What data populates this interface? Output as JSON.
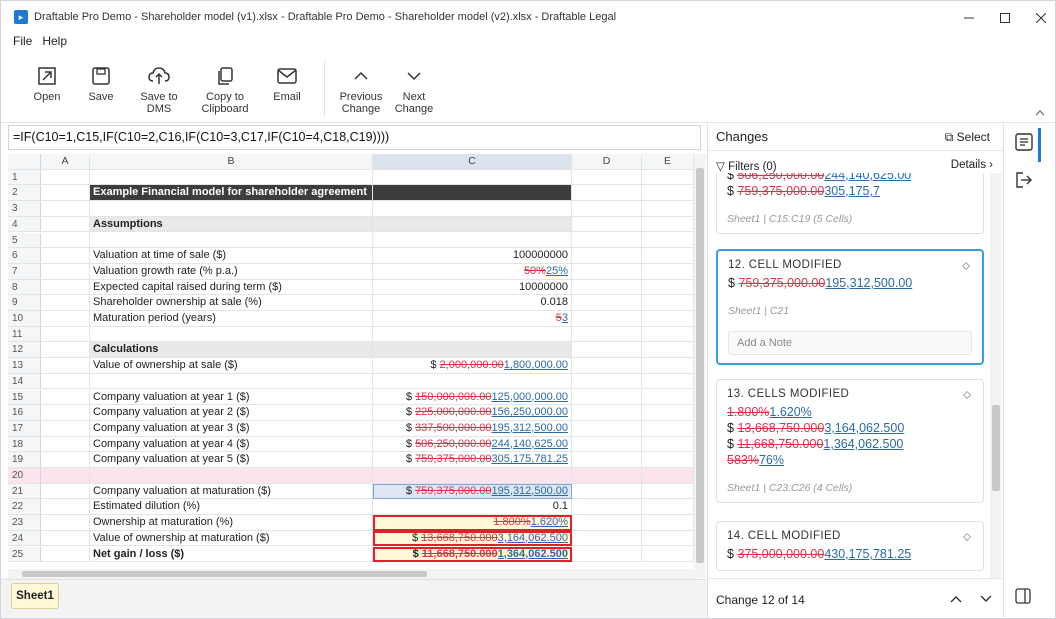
{
  "window": {
    "title": "Draftable Pro Demo - Shareholder model (v1).xlsx - Draftable Pro Demo - Shareholder model (v2).xlsx - Draftable Legal"
  },
  "menu": [
    "File",
    "Help"
  ],
  "ribbon": {
    "open": "Open",
    "save": "Save",
    "save_dms": "Save to\nDMS",
    "copy": "Copy to\nClipboard",
    "email": "Email",
    "prev": "Previous\nChange",
    "next": "Next\nChange"
  },
  "formula": "=IF(C10=1,C15,IF(C10=2,C16,IF(C10=3,C17,IF(C10=4,C18,C19))))",
  "columns": [
    "A",
    "B",
    "C",
    "D",
    "E"
  ],
  "rows": [
    {
      "n": "1",
      "b": "",
      "c": []
    },
    {
      "n": "2",
      "b": "Example Financial model for shareholder agreement",
      "c": [],
      "style": "dark"
    },
    {
      "n": "3",
      "b": "",
      "c": []
    },
    {
      "n": "4",
      "b": "Assumptions",
      "c": [],
      "style": "lgray"
    },
    {
      "n": "5",
      "b": "",
      "c": []
    },
    {
      "n": "6",
      "b": "Valuation at time of sale ($)",
      "c": [
        {
          "t": "100000000"
        }
      ]
    },
    {
      "n": "7",
      "b": "Valuation growth rate (% p.a.)",
      "c": [
        {
          "t": "50%",
          "k": "del"
        },
        {
          "t": "25%",
          "k": "ins"
        }
      ]
    },
    {
      "n": "8",
      "b": "Expected capital raised during term ($)",
      "c": [
        {
          "t": "10000000"
        }
      ]
    },
    {
      "n": "9",
      "b": "Shareholder ownership at sale (%)",
      "c": [
        {
          "t": "0.018"
        }
      ]
    },
    {
      "n": "10",
      "b": "Maturation period (years)",
      "c": [
        {
          "t": "5",
          "k": "del"
        },
        {
          "t": "3",
          "k": "ins"
        }
      ]
    },
    {
      "n": "11",
      "b": "",
      "c": []
    },
    {
      "n": "12",
      "b": "Calculations",
      "c": [],
      "style": "lgray"
    },
    {
      "n": "13",
      "b": "Value of ownership at sale ($)",
      "c": [
        {
          "t": "$ "
        },
        {
          "t": "2,000,000.00",
          "k": "del"
        },
        {
          "t": "1,800,000.00",
          "k": "ins"
        }
      ]
    },
    {
      "n": "14",
      "b": "",
      "c": []
    },
    {
      "n": "15",
      "b": "Company valuation at year 1 ($)",
      "c": [
        {
          "t": "$ "
        },
        {
          "t": "150,000,000.00",
          "k": "del"
        },
        {
          "t": "125,000,000.00",
          "k": "ins"
        }
      ]
    },
    {
      "n": "16",
      "b": "Company valuation at year 2 ($)",
      "c": [
        {
          "t": "$ "
        },
        {
          "t": "225,000,000.00",
          "k": "del"
        },
        {
          "t": "156,250,000.00",
          "k": "ins"
        }
      ]
    },
    {
      "n": "17",
      "b": "Company valuation at year 3 ($)",
      "c": [
        {
          "t": "$ "
        },
        {
          "t": "337,500,000.00",
          "k": "del"
        },
        {
          "t": "195,312,500.00",
          "k": "ins"
        }
      ]
    },
    {
      "n": "18",
      "b": "Company valuation at year 4 ($)",
      "c": [
        {
          "t": "$ "
        },
        {
          "t": "506,250,000.00",
          "k": "del"
        },
        {
          "t": "244,140,625.00",
          "k": "ins"
        }
      ]
    },
    {
      "n": "19",
      "b": "Company valuation at year 5 ($)",
      "c": [
        {
          "t": "$ "
        },
        {
          "t": "759,375,000.00",
          "k": "del"
        },
        {
          "t": "305,175,781.25",
          "k": "ins"
        }
      ]
    },
    {
      "n": "20",
      "b": "",
      "c": [],
      "style": "pink"
    },
    {
      "n": "21",
      "b": "Company valuation at maturation ($)",
      "c": [
        {
          "t": "$ "
        },
        {
          "t": "759,375,000.00",
          "k": "del"
        },
        {
          "t": "195,312,500.00",
          "k": "ins"
        }
      ],
      "cstyle": "selC"
    },
    {
      "n": "22",
      "b": "Estimated dilution (%)",
      "c": [
        {
          "t": "0.1"
        }
      ]
    },
    {
      "n": "23",
      "b": "Ownership at maturation (%)",
      "c": [
        {
          "t": "1.800%",
          "k": "del"
        },
        {
          "t": "1.620%",
          "k": "ins"
        }
      ],
      "cstyle": "redbox"
    },
    {
      "n": "24",
      "b": "Value of ownership at maturation ($)",
      "c": [
        {
          "t": "$ "
        },
        {
          "t": "13,668,750.000",
          "k": "del"
        },
        {
          "t": "3,164,062.500",
          "k": "ins"
        }
      ],
      "cstyle": "redbox"
    },
    {
      "n": "25",
      "b": "Net gain / loss ($)",
      "c": [
        {
          "t": "$ "
        },
        {
          "t": "11,668,750.000",
          "k": "del"
        },
        {
          "t": "1,364,062.500",
          "k": "ins"
        }
      ],
      "cstyle": "redbox",
      "bold": true
    }
  ],
  "sheet_tab": "Sheet1",
  "panel": {
    "title": "Changes",
    "select": "Select",
    "filters": "Filters (0)",
    "details": "Details",
    "cards": [
      {
        "heading": "",
        "lines": [
          [
            {
              "t": "$ "
            },
            {
              "t": "506,250,000.00",
              "k": "del"
            },
            {
              "t": "244,140,625.00",
              "k": "ins"
            }
          ],
          [
            {
              "t": "$ "
            },
            {
              "t": "759,375,000.00",
              "k": "del"
            },
            {
              "t": "305,175,7",
              "k": "ins"
            }
          ]
        ],
        "meta": "Sheet1 | C15:C19 (5 Cells)",
        "partial": true
      },
      {
        "heading": "12. CELL MODIFIED",
        "lines": [
          [
            {
              "t": "$ "
            },
            {
              "t": "759,375,000.00",
              "k": "del"
            },
            {
              "t": "195,312,500.00",
              "k": "ins"
            }
          ]
        ],
        "meta": "Sheet1 | C21",
        "active": true,
        "note": "Add a Note"
      },
      {
        "heading": "13. CELLS MODIFIED",
        "lines": [
          [
            {
              "t": "1.800%",
              "k": "del"
            },
            {
              "t": "1.620%",
              "k": "ins"
            }
          ],
          [
            {
              "t": "$ "
            },
            {
              "t": "13,668,750.000",
              "k": "del"
            },
            {
              "t": "3,164,062.500",
              "k": "ins"
            }
          ],
          [
            {
              "t": "$ "
            },
            {
              "t": "11,668,750.000",
              "k": "del"
            },
            {
              "t": "1,364,062.500",
              "k": "ins"
            }
          ],
          [
            {
              "t": "583%",
              "k": "del"
            },
            {
              "t": "76%",
              "k": "ins"
            }
          ]
        ],
        "meta": "Sheet1 | C23:C26 (4 Cells)"
      },
      {
        "heading": "14. CELL MODIFIED",
        "lines": [
          [
            {
              "t": "$ "
            },
            {
              "t": "375,000,000.00",
              "k": "del"
            },
            {
              "t": "430,175,781.25",
              "k": "ins"
            }
          ]
        ],
        "meta": ""
      }
    ],
    "footer": "Change 12 of 14"
  }
}
